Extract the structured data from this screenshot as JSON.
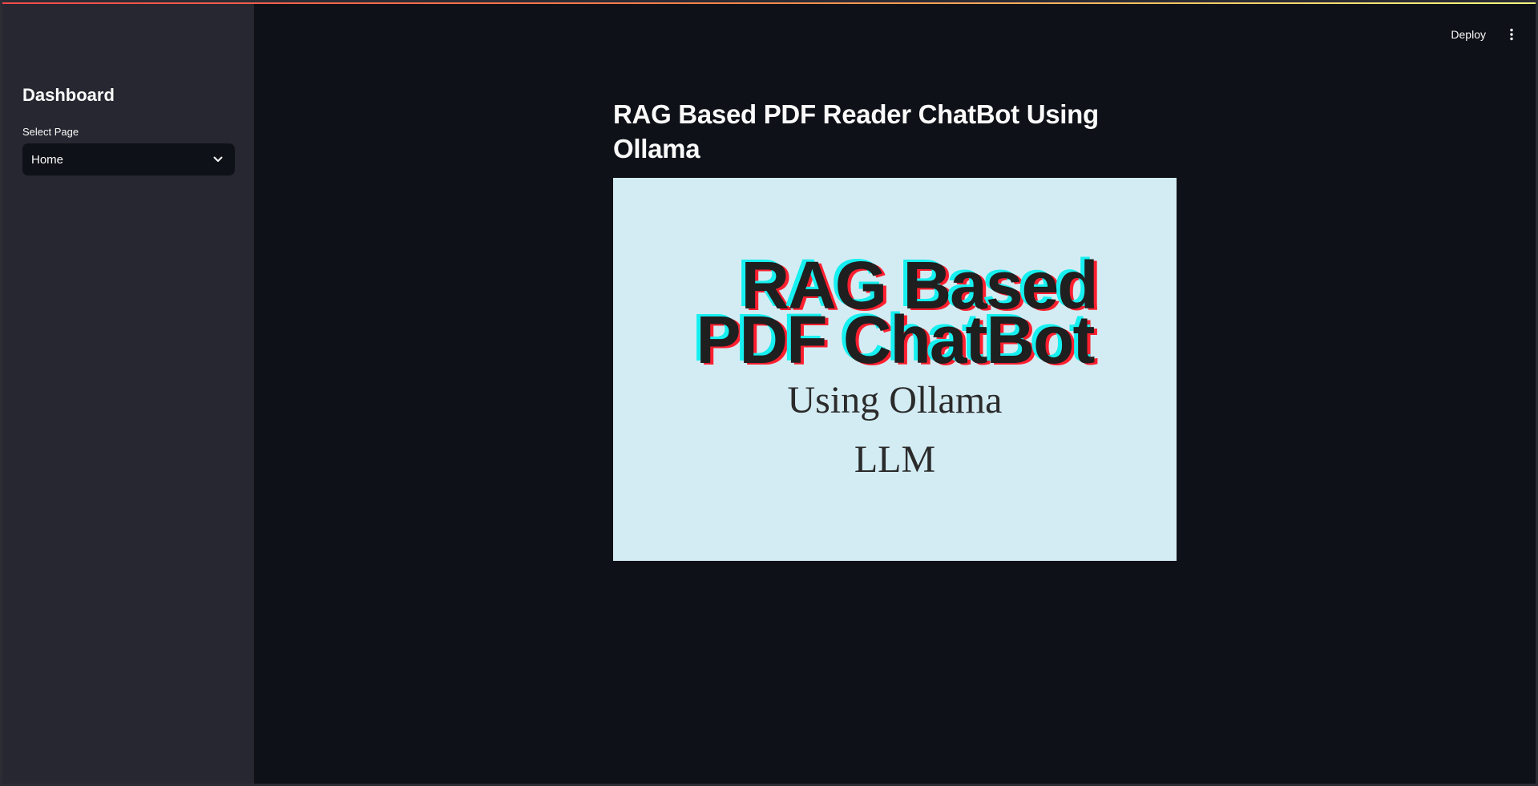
{
  "sidebar": {
    "title": "Dashboard",
    "select_label": "Select Page",
    "select_value": "Home"
  },
  "toolbar": {
    "deploy_label": "Deploy"
  },
  "main": {
    "title": "RAG Based PDF Reader ChatBot Using Ollama",
    "banner": {
      "line1": "RAG Based",
      "line2": "PDF ChatBot",
      "line3": "Using Ollama",
      "line4": "LLM",
      "background": "#d3ecf3"
    }
  },
  "colors": {
    "app_bg": "#0e1117",
    "sidebar_bg": "#262730",
    "text": "#fafafa",
    "accent_red": "#ff4b4b"
  },
  "icons": {
    "select_chevron": "chevron-down-icon",
    "main_menu": "more-vertical-icon"
  }
}
